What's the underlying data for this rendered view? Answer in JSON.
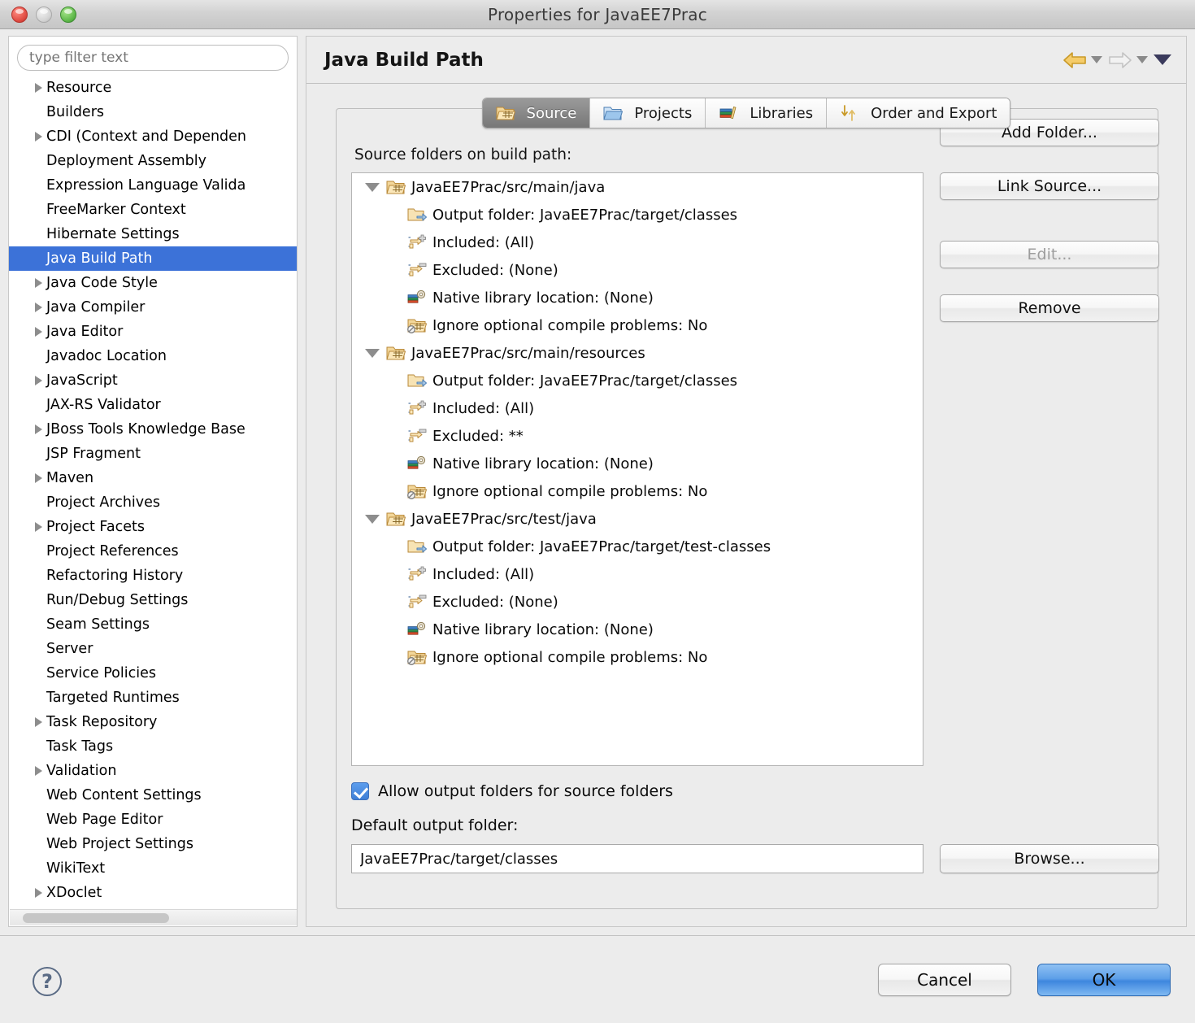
{
  "window": {
    "title": "Properties for JavaEE7Prac",
    "traffic_lights": [
      "close",
      "minimize",
      "zoom"
    ]
  },
  "sidebar": {
    "filter_placeholder": "type filter text",
    "filter_value": "",
    "items": [
      {
        "label": "Resource",
        "expandable": true,
        "selected": false
      },
      {
        "label": "Builders",
        "expandable": false,
        "selected": false
      },
      {
        "label": "CDI (Context and Dependen",
        "expandable": true,
        "selected": false
      },
      {
        "label": "Deployment Assembly",
        "expandable": false,
        "selected": false
      },
      {
        "label": "Expression Language Valida",
        "expandable": false,
        "selected": false
      },
      {
        "label": "FreeMarker Context",
        "expandable": false,
        "selected": false
      },
      {
        "label": "Hibernate Settings",
        "expandable": false,
        "selected": false
      },
      {
        "label": "Java Build Path",
        "expandable": false,
        "selected": true
      },
      {
        "label": "Java Code Style",
        "expandable": true,
        "selected": false
      },
      {
        "label": "Java Compiler",
        "expandable": true,
        "selected": false
      },
      {
        "label": "Java Editor",
        "expandable": true,
        "selected": false
      },
      {
        "label": "Javadoc Location",
        "expandable": false,
        "selected": false
      },
      {
        "label": "JavaScript",
        "expandable": true,
        "selected": false
      },
      {
        "label": "JAX-RS Validator",
        "expandable": false,
        "selected": false
      },
      {
        "label": "JBoss Tools Knowledge Base",
        "expandable": true,
        "selected": false
      },
      {
        "label": "JSP Fragment",
        "expandable": false,
        "selected": false
      },
      {
        "label": "Maven",
        "expandable": true,
        "selected": false
      },
      {
        "label": "Project Archives",
        "expandable": false,
        "selected": false
      },
      {
        "label": "Project Facets",
        "expandable": true,
        "selected": false
      },
      {
        "label": "Project References",
        "expandable": false,
        "selected": false
      },
      {
        "label": "Refactoring History",
        "expandable": false,
        "selected": false
      },
      {
        "label": "Run/Debug Settings",
        "expandable": false,
        "selected": false
      },
      {
        "label": "Seam Settings",
        "expandable": false,
        "selected": false
      },
      {
        "label": "Server",
        "expandable": false,
        "selected": false
      },
      {
        "label": "Service Policies",
        "expandable": false,
        "selected": false
      },
      {
        "label": "Targeted Runtimes",
        "expandable": false,
        "selected": false
      },
      {
        "label": "Task Repository",
        "expandable": true,
        "selected": false
      },
      {
        "label": "Task Tags",
        "expandable": false,
        "selected": false
      },
      {
        "label": "Validation",
        "expandable": true,
        "selected": false
      },
      {
        "label": "Web Content Settings",
        "expandable": false,
        "selected": false
      },
      {
        "label": "Web Page Editor",
        "expandable": false,
        "selected": false
      },
      {
        "label": "Web Project Settings",
        "expandable": false,
        "selected": false
      },
      {
        "label": "WikiText",
        "expandable": false,
        "selected": false
      },
      {
        "label": "XDoclet",
        "expandable": true,
        "selected": false
      }
    ]
  },
  "page": {
    "title": "Java Build Path",
    "nav": {
      "back_icon": "back-arrow-icon",
      "back_enabled": true,
      "forward_icon": "forward-arrow-icon",
      "forward_enabled": false,
      "menu_icon": "chevron-down-icon"
    }
  },
  "tabs": [
    {
      "label": "Source",
      "icon": "source-folder-icon",
      "active": true
    },
    {
      "label": "Projects",
      "icon": "projects-folder-icon",
      "active": false
    },
    {
      "label": "Libraries",
      "icon": "libraries-books-icon",
      "active": false
    },
    {
      "label": "Order and Export",
      "icon": "order-export-arrows-icon",
      "active": false
    }
  ],
  "source_panel": {
    "group_label": "Source folders on build path:",
    "tree": [
      {
        "label": "JavaEE7Prac/src/main/java",
        "icon": "source-folder-icon",
        "expanded": true,
        "children": [
          {
            "label": "Output folder: JavaEE7Prac/target/classes",
            "icon": "output-folder-icon"
          },
          {
            "label": "Included: (All)",
            "icon": "included-filter-icon"
          },
          {
            "label": "Excluded: (None)",
            "icon": "excluded-filter-icon"
          },
          {
            "label": "Native library location: (None)",
            "icon": "native-library-icon"
          },
          {
            "label": "Ignore optional compile problems: No",
            "icon": "ignore-problems-icon"
          }
        ]
      },
      {
        "label": "JavaEE7Prac/src/main/resources",
        "icon": "source-folder-icon",
        "expanded": true,
        "children": [
          {
            "label": "Output folder: JavaEE7Prac/target/classes",
            "icon": "output-folder-icon"
          },
          {
            "label": "Included: (All)",
            "icon": "included-filter-icon"
          },
          {
            "label": "Excluded: **",
            "icon": "excluded-filter-icon"
          },
          {
            "label": "Native library location: (None)",
            "icon": "native-library-icon"
          },
          {
            "label": "Ignore optional compile problems: No",
            "icon": "ignore-problems-icon"
          }
        ]
      },
      {
        "label": "JavaEE7Prac/src/test/java",
        "icon": "source-folder-icon",
        "expanded": true,
        "children": [
          {
            "label": "Output folder: JavaEE7Prac/target/test-classes",
            "icon": "output-folder-icon"
          },
          {
            "label": "Included: (All)",
            "icon": "included-filter-icon"
          },
          {
            "label": "Excluded: (None)",
            "icon": "excluded-filter-icon"
          },
          {
            "label": "Native library location: (None)",
            "icon": "native-library-icon"
          },
          {
            "label": "Ignore optional compile problems: No",
            "icon": "ignore-problems-icon"
          }
        ]
      }
    ],
    "side_buttons": [
      {
        "label": "Add Folder...",
        "enabled": true
      },
      {
        "label": "Link Source...",
        "enabled": true
      },
      {
        "label": "Edit...",
        "enabled": false
      },
      {
        "label": "Remove",
        "enabled": true
      }
    ],
    "allow_output_folders": {
      "label": "Allow output folders for source folders",
      "checked": true
    },
    "default_output_folder": {
      "label": "Default output folder:",
      "value": "JavaEE7Prac/target/classes",
      "browse_label": "Browse..."
    }
  },
  "footer": {
    "help_icon": "help-question-icon",
    "help_glyph": "?",
    "cancel_label": "Cancel",
    "ok_label": "OK"
  },
  "colors": {
    "selection_blue": "#3c72d8",
    "default_button_blue": "#3d86de",
    "window_bg": "#ececec",
    "checkbox_blue": "#3f7fd6"
  }
}
